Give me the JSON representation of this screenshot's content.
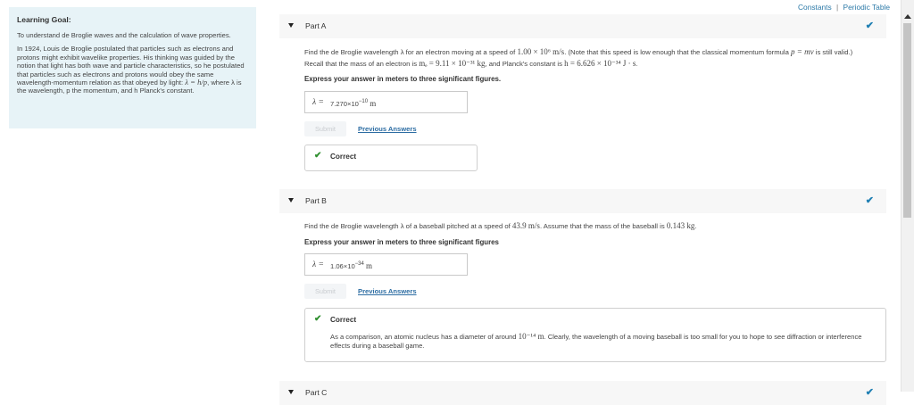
{
  "top_links": {
    "constants": "Constants",
    "separator": "|",
    "periodic_table": "Periodic Table"
  },
  "sidebar": {
    "title": "Learning Goal:",
    "intro": "To understand de Broglie waves and the calculation of wave properties.",
    "body_1": "In 1924, Louis de Broglie postulated that particles such as electrons and protons might exhibit wavelike properties. His thinking was guided by the notion that light has both wave and particle characteristics, so he postulated that particles such as electrons and protons would obey the same wavelength-momentum relation as that obeyed by light:",
    "formula": "λ = h/p",
    "body_2": ", where λ is the wavelength, p the momentum, and h Planck's constant."
  },
  "part_a": {
    "label": "Part A",
    "question_1": "Find the de Broglie wavelength λ for an electron moving at a speed of",
    "speed": "1.00 × 10⁶ m/s",
    "question_2": ". (Note that this speed is low enough that the classical momentum formula",
    "formula": "p = mv",
    "question_3": "is still valid.) Recall that the mass of an electron is",
    "mass": "mₑ = 9.11 × 10⁻³¹ kg",
    "question_4": ", and Planck's constant is",
    "planck": "h = 6.626 × 10⁻³⁴ J · s",
    "question_5": ".",
    "instruction": "Express your answer in meters to three significant figures.",
    "answer_symbol": "λ =",
    "answer_mantissa": "7.270×10",
    "answer_exp": "−10",
    "answer_unit": "m",
    "submit": "Submit",
    "previous_answers": "Previous Answers",
    "result": "Correct"
  },
  "part_b": {
    "label": "Part B",
    "question_1": "Find the de Broglie wavelength λ of a baseball pitched at a speed of",
    "speed": "43.9 m/s",
    "question_2": ". Assume that the mass of the baseball is",
    "mass": "0.143 kg",
    "question_3": ".",
    "instruction": "Express your answer in meters to three significant figures",
    "answer_symbol": "λ =",
    "answer_mantissa": "1.06×10",
    "answer_exp": "−34",
    "answer_unit": "m",
    "submit": "Submit",
    "previous_answers": "Previous Answers",
    "result": "Correct",
    "note_1": "As a comparison, an atomic nucleus has a diameter of around",
    "note_value": "10⁻¹⁴ m",
    "note_2": ". Clearly, the wavelength of a moving baseball is too small for you to hope to see diffraction or interference effects during a baseball game."
  },
  "part_c": {
    "label": "Part C"
  },
  "colors": {
    "accent": "#1f7fb3",
    "sidebar_bg": "#e7f3f7",
    "correct": "#2f8f2f",
    "link": "#2d6da3"
  }
}
